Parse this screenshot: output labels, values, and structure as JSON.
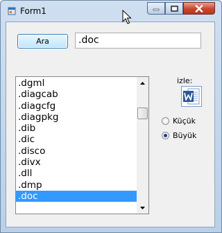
{
  "window": {
    "title": "Form1",
    "controls": [
      "minimize-icon",
      "maximize-icon",
      "close-icon"
    ]
  },
  "search": {
    "button_label": "Ara",
    "value": ".doc"
  },
  "listbox": {
    "items": [
      ".dgml",
      ".diagcab",
      ".diagcfg",
      ".diagpkg",
      ".dib",
      ".dic",
      ".disco",
      ".divx",
      ".dll",
      ".dmp",
      ".doc"
    ],
    "selected": ".doc"
  },
  "preview": {
    "label": "izle:",
    "icon": "word-document-icon"
  },
  "size_options": {
    "small_label": "Küçük",
    "large_label": "Büyük",
    "selected": "Büyük"
  },
  "colors": {
    "selection": "#3399ff",
    "close_button": "#c8452b",
    "word_blue": "#2b5797"
  }
}
